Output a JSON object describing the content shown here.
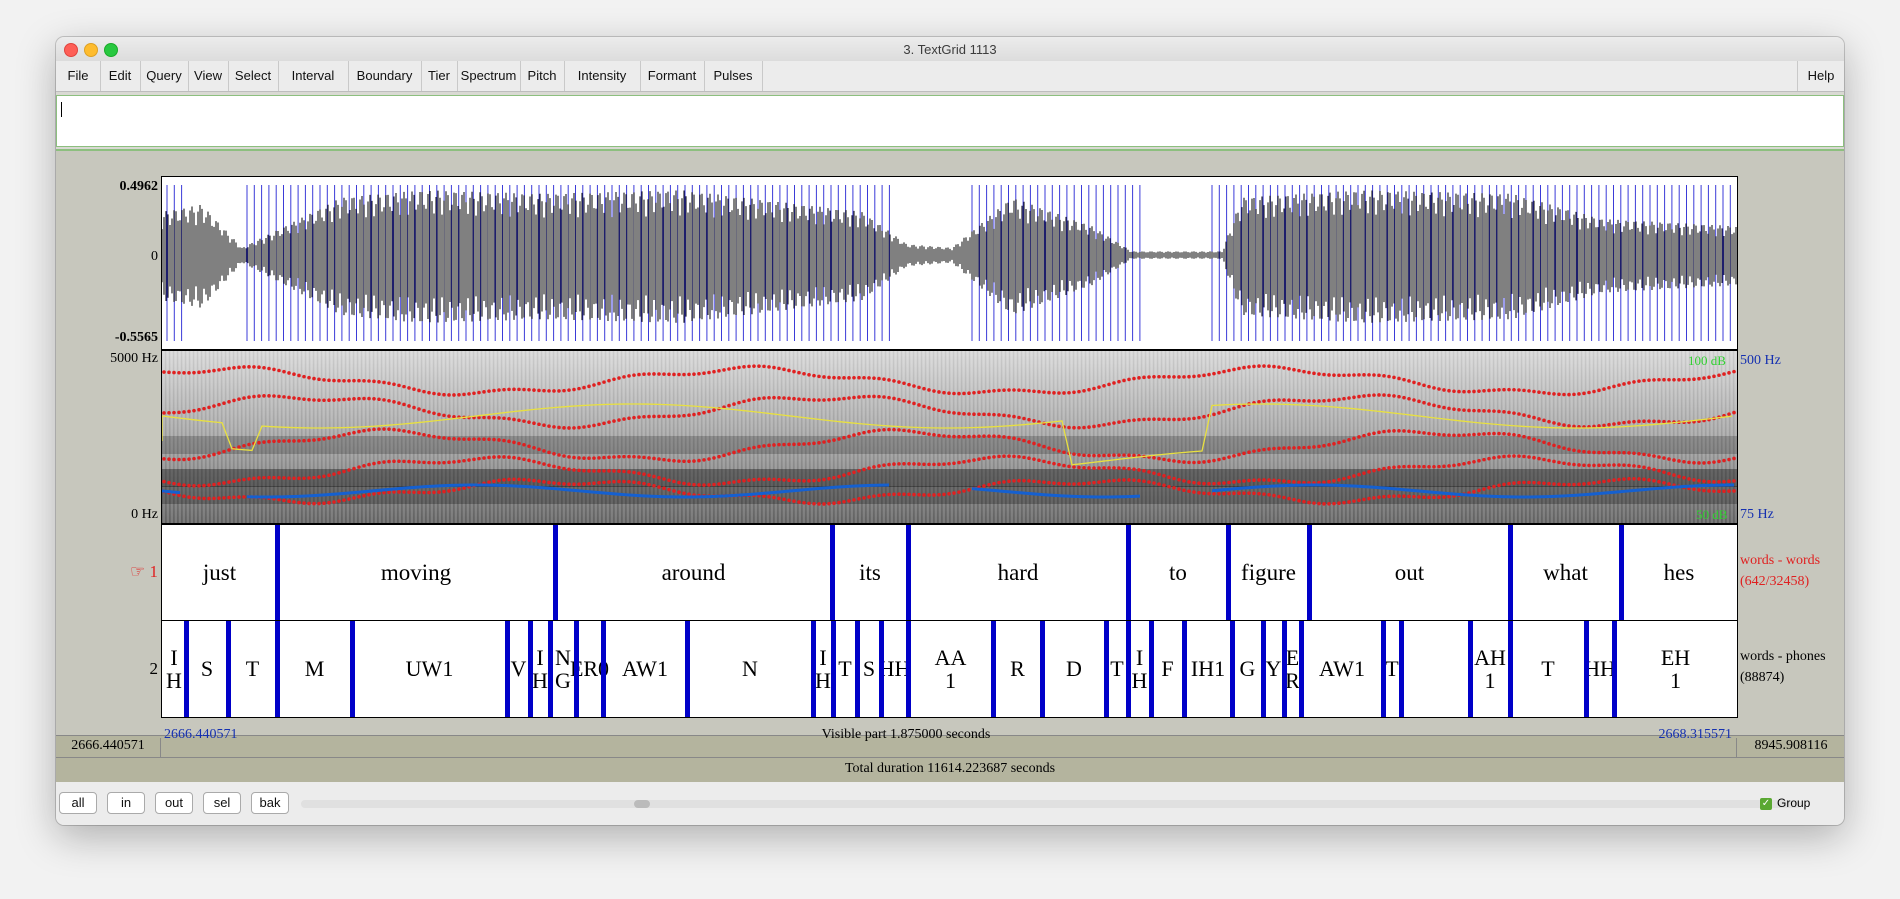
{
  "window": {
    "title": "3. TextGrid 1113"
  },
  "menus": [
    "File",
    "Edit",
    "Query",
    "View",
    "Select",
    "Interval",
    "Boundary",
    "Tier",
    "Spectrum",
    "Pitch",
    "Intensity",
    "Formant",
    "Pulses"
  ],
  "help_label": "Help",
  "waveform": {
    "max": "0.4962",
    "zero": "0",
    "min": "-0.5565"
  },
  "spectrogram": {
    "top_hz": "5000 Hz",
    "bottom_hz": "0 Hz",
    "right_top_db": "100 dB",
    "right_top_pitch": "500 Hz",
    "right_bottom_db": "50 dB",
    "right_bottom_pitch": "75 Hz"
  },
  "tiers": [
    {
      "number": "1",
      "marker": "☞",
      "name": "words - words",
      "count": "(642/32458)",
      "intervals": [
        "just",
        "moving",
        "around",
        "its",
        "hard",
        "to",
        "figure",
        "out",
        "what",
        "hes"
      ]
    },
    {
      "number": "2",
      "name": "words - phones",
      "count": "(88874)",
      "intervals": [
        "I\nH",
        "S",
        "T",
        "M",
        "UW1",
        "V",
        "I\nH",
        "N\nG",
        "ER0",
        "AW1",
        "N",
        "I\nH",
        "T",
        "S",
        "HH",
        "AA\n1",
        "R",
        "D",
        "T",
        "I\nH",
        "F",
        "IH1",
        "G",
        "Y",
        "E\nR",
        "AW1",
        "T",
        "",
        "AH\n1",
        "T",
        "HH",
        "EH\n1"
      ]
    }
  ],
  "time": {
    "left_window": "2666.440571",
    "start": "2666.440571",
    "visible": "Visible part 1.875000 seconds",
    "end": "2668.315571",
    "right_window": "8945.908116"
  },
  "total": "Total duration 11614.223687 seconds",
  "buttons": [
    "all",
    "in",
    "out",
    "sel",
    "bak"
  ],
  "group": {
    "label": "Group",
    "checked": true
  },
  "colors": {
    "boundary": "#0000c8",
    "formant": "#e02020",
    "pitch": "#1560d0",
    "intensity": "#e8e040",
    "tier_label": "#e02020",
    "time_blue": "#0000c8"
  }
}
